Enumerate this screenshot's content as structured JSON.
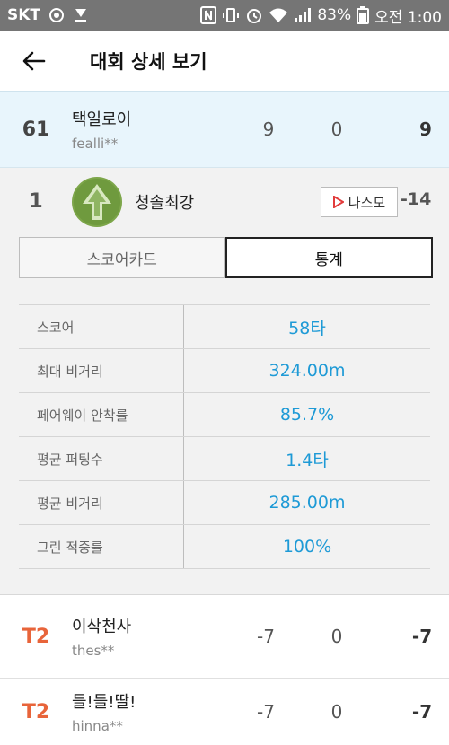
{
  "status_bar": {
    "carrier": "SKT",
    "battery": "83%",
    "time": "오전 1:00"
  },
  "app_bar": {
    "title": "대회 상세 보기"
  },
  "top_row": {
    "rank": "61",
    "name": "택일로이",
    "user_id": "fealli**",
    "col1": "9",
    "col2": "0",
    "col3": "9"
  },
  "me_row": {
    "rank": "1",
    "name": "청솔최강",
    "nasmo_label": "나스모",
    "score": "-14"
  },
  "tabs": {
    "scorecard": "스코어카드",
    "stats": "통계"
  },
  "stats": [
    {
      "label": "스코어",
      "value": "58타"
    },
    {
      "label": "최대 비거리",
      "value": "324.00m"
    },
    {
      "label": "페어웨이 안착률",
      "value": "85.7%"
    },
    {
      "label": "평균 퍼팅수",
      "value": "1.4타"
    },
    {
      "label": "평균 비거리",
      "value": "285.00m"
    },
    {
      "label": "그린 적중률",
      "value": "100%"
    }
  ],
  "rows": [
    {
      "rank": "T2",
      "name": "이삭천사",
      "user_id": "thes**",
      "col1": "-7",
      "col2": "0",
      "col3": "-7"
    },
    {
      "rank": "T2",
      "name": "들!들!딸!",
      "user_id": "hinna**",
      "col1": "-7",
      "col2": "0",
      "col3": "-7"
    }
  ],
  "colors": {
    "accent_blue": "#1e9ad6",
    "rank_orange": "#e8643a",
    "highlight_row": "#e8f5fc",
    "status_bar": "#757575"
  }
}
